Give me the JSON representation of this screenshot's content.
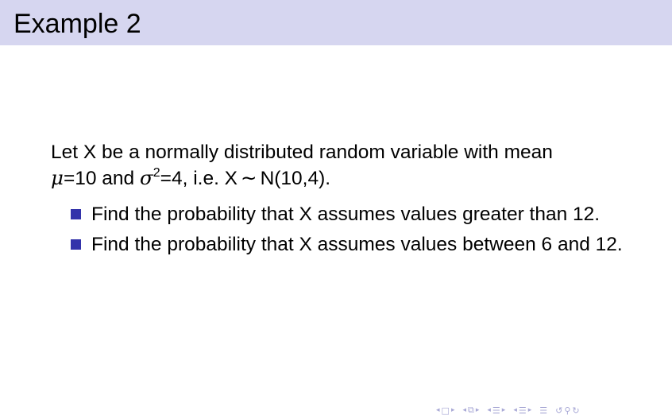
{
  "slide": {
    "title": "Example 2",
    "intro": {
      "line1": "Let X be a normally distributed random variable with mean",
      "mu": "μ",
      "mu_value": "=10 and ",
      "sigma": "σ",
      "sigma_exp": "2",
      "sigma_value": "=4, i.e. X",
      "tilde": "∼",
      "dist": "N(10,4)."
    },
    "bullets": [
      "Find the probability that X assumes values greater than 12.",
      "Find the probability that X assumes values between 6 and 12."
    ]
  },
  "navigation": {
    "icons": [
      "frame-prev-icon",
      "frame-icon",
      "frame-next-icon",
      "subsection-prev-icon",
      "subsection-icon",
      "subsection-next-icon",
      "section-prev-icon",
      "section-icon",
      "section-next-icon",
      "slide-align-icon",
      "search-icon"
    ],
    "color": "#a9a9d6"
  },
  "colors": {
    "title_bar": "#d6d6f0",
    "bullet": "#3333aa"
  }
}
